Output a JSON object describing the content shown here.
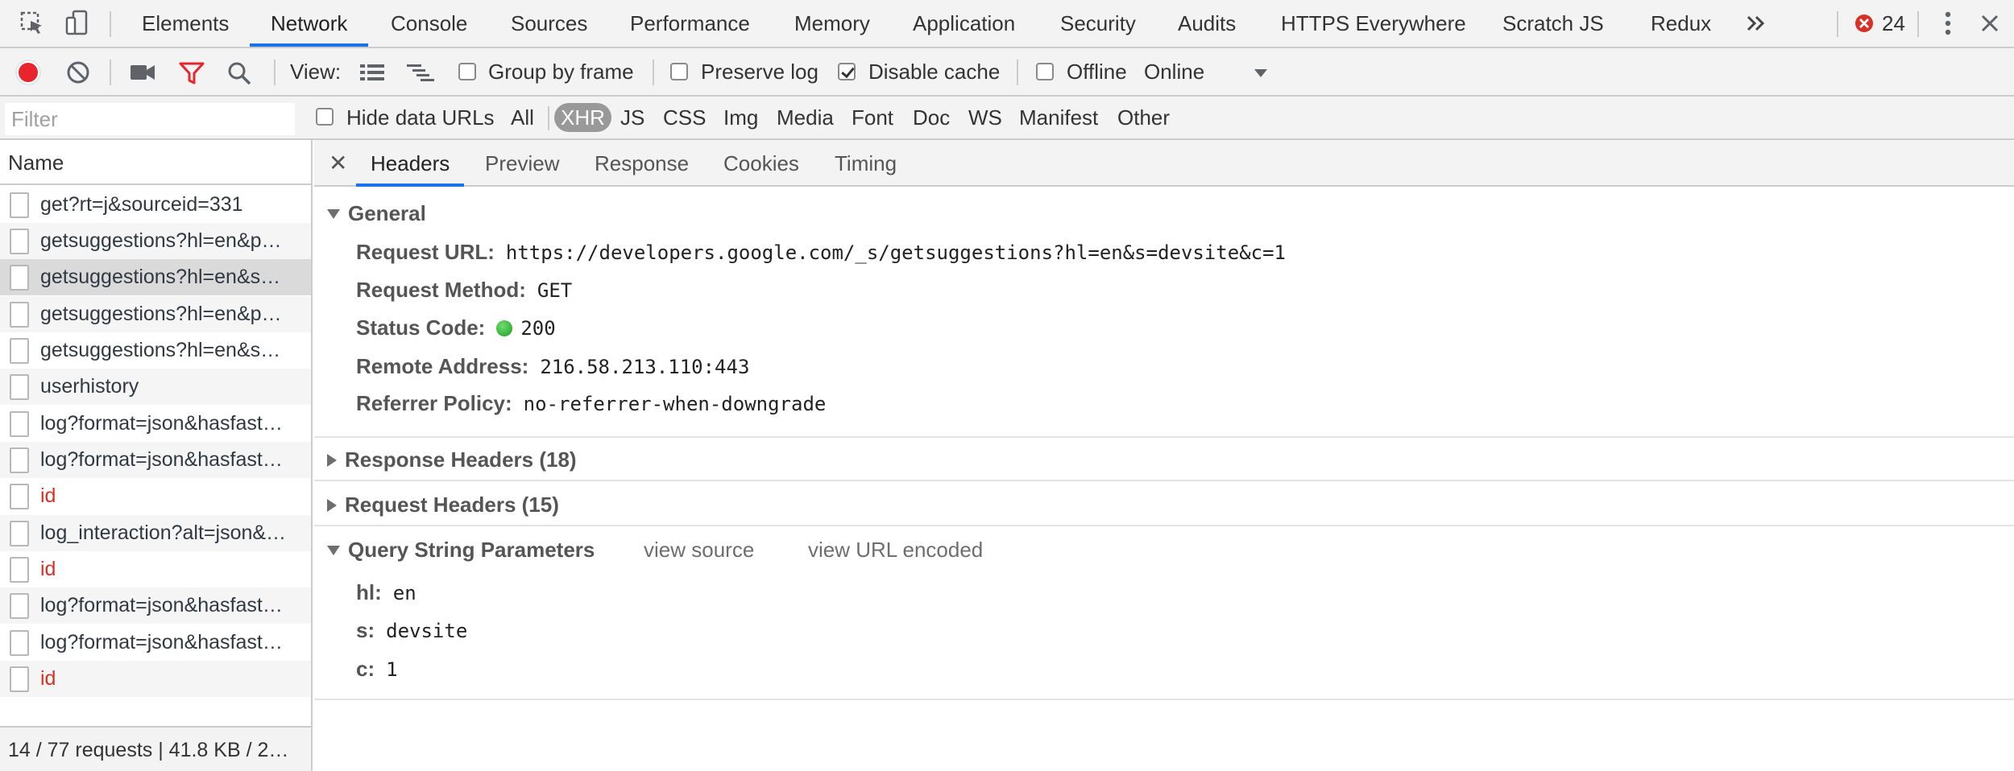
{
  "tabbar": {
    "tabs": [
      "Elements",
      "Network",
      "Console",
      "Sources",
      "Performance",
      "Memory",
      "Application",
      "Security",
      "Audits",
      "HTTPS Everywhere",
      "Scratch JS",
      "Redux"
    ],
    "active_tab": "Network",
    "overflow_icon": "chevron-double-right-icon",
    "error_count": "24",
    "colors": {
      "accent": "#1a73e8",
      "error": "#d93025"
    }
  },
  "toolbar": {
    "view_label": "View:",
    "group_by_frame": {
      "label": "Group by frame",
      "checked": false
    },
    "preserve_log": {
      "label": "Preserve log",
      "checked": false
    },
    "disable_cache": {
      "label": "Disable cache",
      "checked": true
    },
    "offline": {
      "label": "Offline",
      "checked": false
    },
    "throttling": "Online"
  },
  "filterbar": {
    "placeholder": "Filter",
    "hide_data_urls": "Hide data URLs",
    "types": [
      "All",
      "XHR",
      "JS",
      "CSS",
      "Img",
      "Media",
      "Font",
      "Doc",
      "WS",
      "Manifest",
      "Other"
    ],
    "active_type": "XHR"
  },
  "requests": {
    "header": "Name",
    "rows": [
      {
        "name": "get?rt=j&sourceid=331",
        "error": false
      },
      {
        "name": "getsuggestions?hl=en&p…",
        "error": false
      },
      {
        "name": "getsuggestions?hl=en&s…",
        "error": false,
        "selected": true
      },
      {
        "name": "getsuggestions?hl=en&p…",
        "error": false
      },
      {
        "name": "getsuggestions?hl=en&s…",
        "error": false
      },
      {
        "name": "userhistory",
        "error": false
      },
      {
        "name": "log?format=json&hasfast…",
        "error": false
      },
      {
        "name": "log?format=json&hasfast…",
        "error": false
      },
      {
        "name": "id",
        "error": true
      },
      {
        "name": "log_interaction?alt=json&…",
        "error": false
      },
      {
        "name": "id",
        "error": true
      },
      {
        "name": "log?format=json&hasfast…",
        "error": false
      },
      {
        "name": "log?format=json&hasfast…",
        "error": false
      },
      {
        "name": "id",
        "error": true
      }
    ],
    "status": "14 / 77 requests | 41.8 KB / 2…"
  },
  "details": {
    "tabs": [
      "Headers",
      "Preview",
      "Response",
      "Cookies",
      "Timing"
    ],
    "active_tab": "Headers",
    "general": {
      "title": "General",
      "request_url_label": "Request URL:",
      "request_url": "https://developers.google.com/_s/getsuggestions?hl=en&s=devsite&c=1",
      "request_method_label": "Request Method:",
      "request_method": "GET",
      "status_code_label": "Status Code:",
      "status_code": "200",
      "remote_address_label": "Remote Address:",
      "remote_address": "216.58.213.110:443",
      "referrer_policy_label": "Referrer Policy:",
      "referrer_policy": "no-referrer-when-downgrade"
    },
    "response_headers": "Response Headers (18)",
    "request_headers": "Request Headers (15)",
    "query_params": {
      "title": "Query String Parameters",
      "view_source": "view source",
      "view_url_encoded": "view URL encoded",
      "params": [
        {
          "key": "hl:",
          "value": "en"
        },
        {
          "key": "s:",
          "value": "devsite"
        },
        {
          "key": "c:",
          "value": "1"
        }
      ]
    }
  }
}
